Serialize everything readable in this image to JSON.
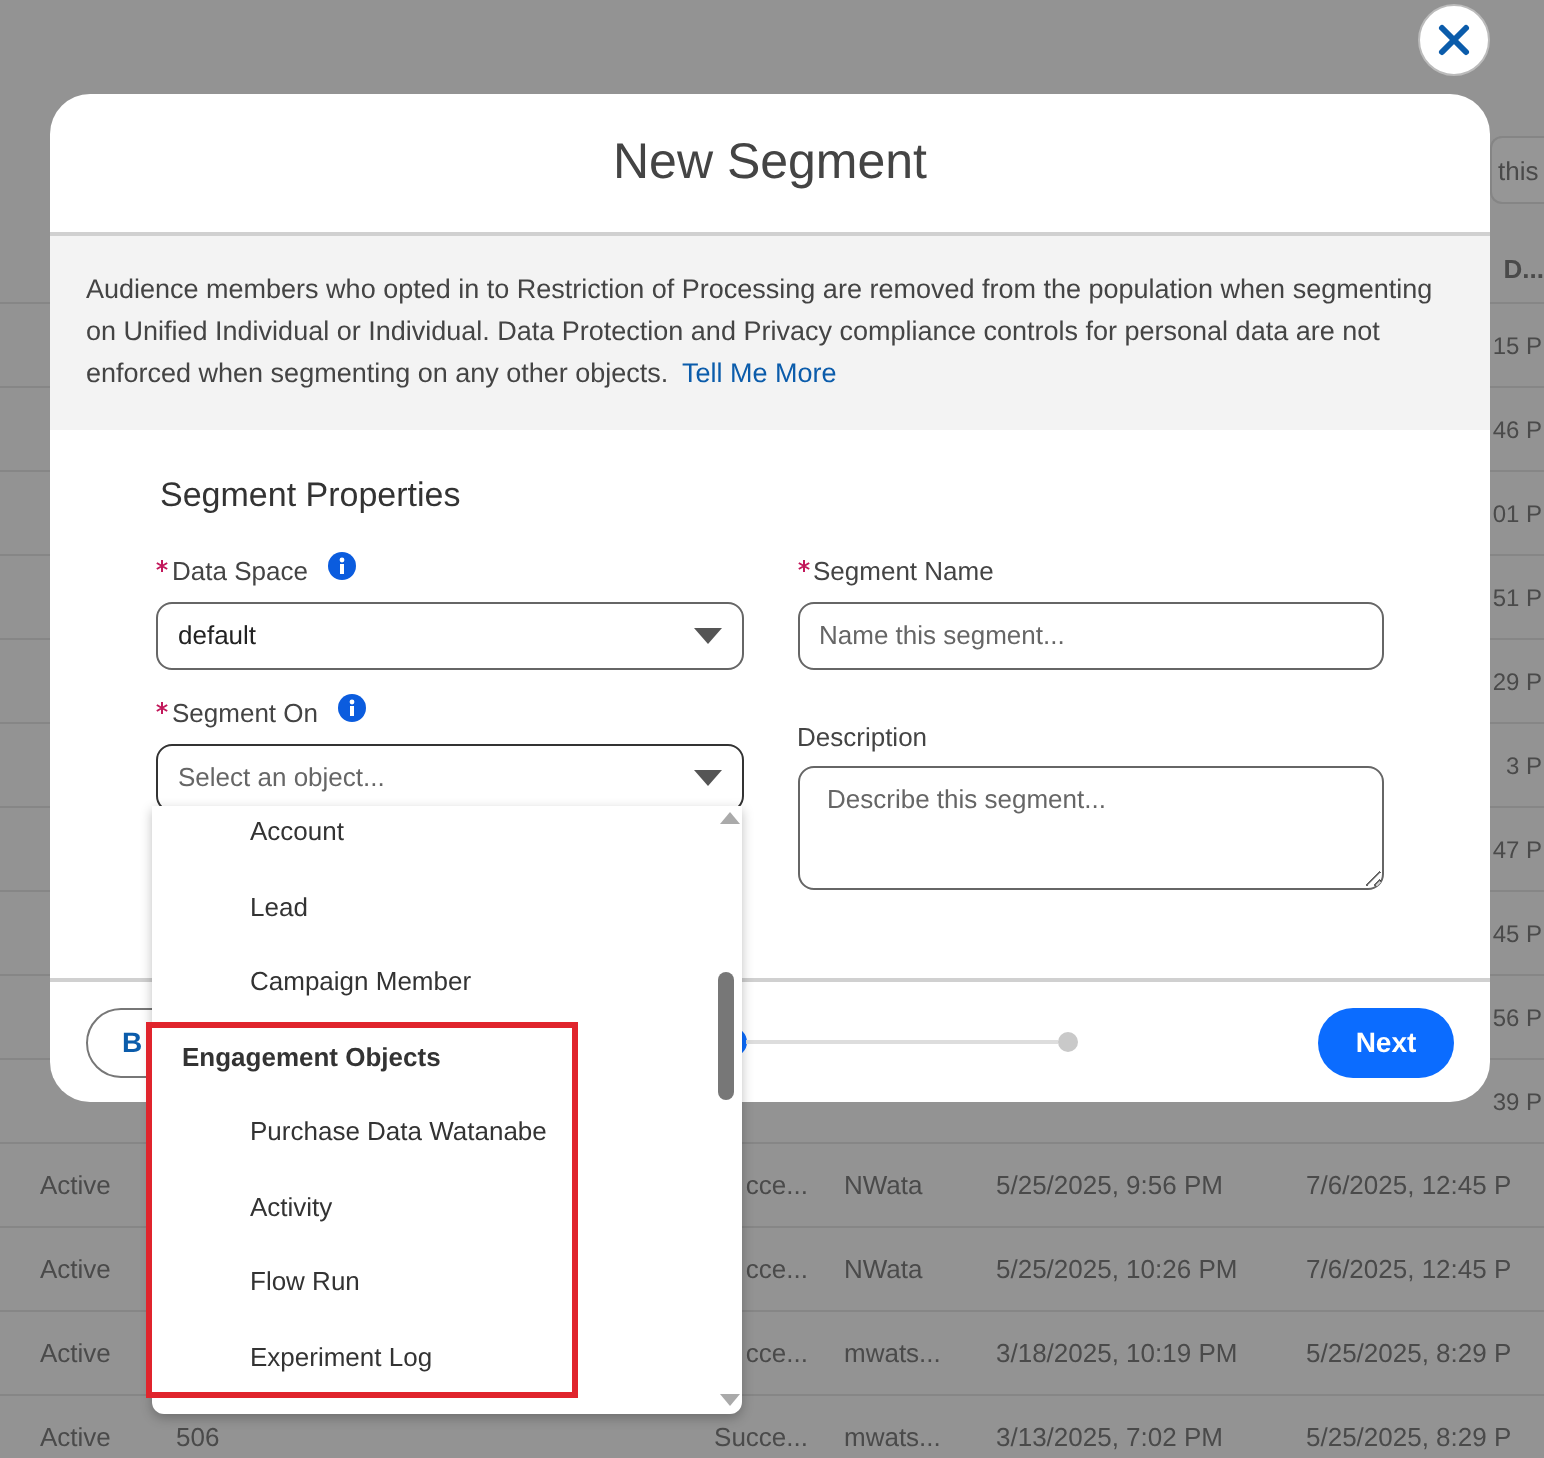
{
  "background": {
    "search_field": {
      "placeholder": "this"
    },
    "header": {
      "column_last": "D..."
    },
    "rows": [
      {
        "kind": "covered",
        "modified": "15 P"
      },
      {
        "kind": "covered",
        "modified": "46 P"
      },
      {
        "kind": "covered",
        "modified": "01 P"
      },
      {
        "kind": "covered",
        "modified": "51 P"
      },
      {
        "kind": "covered",
        "modified": "29 P"
      },
      {
        "kind": "covered",
        "modified": "3 P"
      },
      {
        "kind": "covered",
        "modified": "47 P"
      },
      {
        "kind": "covered",
        "modified": "45 P"
      },
      {
        "kind": "covered",
        "modified": "56 P"
      },
      {
        "kind": "covered",
        "modified": "39 P"
      },
      {
        "kind": "full",
        "status": "Active",
        "state": "cce...",
        "owner": "NWata",
        "created": "5/25/2025, 9:56 PM",
        "modified": "7/6/2025, 12:45 P"
      },
      {
        "kind": "full",
        "status": "Active",
        "state": "cce...",
        "owner": "NWata",
        "created": "5/25/2025, 10:26 PM",
        "modified": "7/6/2025, 12:45 P"
      },
      {
        "kind": "full",
        "status": "Active",
        "state": "cce...",
        "owner": "mwats...",
        "created": "3/18/2025, 10:19 PM",
        "modified": "5/25/2025, 8:29 P"
      },
      {
        "kind": "full",
        "status": "Active",
        "id": "506",
        "state": "Succe...",
        "owner": "mwats...",
        "created": "3/13/2025, 7:02 PM",
        "modified": "5/25/2025, 8:29 P"
      }
    ]
  },
  "modal": {
    "title": "New Segment",
    "notice": {
      "text": "Audience members who opted in to Restriction of Processing are removed from the population when segmenting on Unified Individual or Individual. Data Protection and Privacy compliance controls for personal data are not enforced when segmenting on any other objects.",
      "link": "Tell Me More"
    },
    "section_title": "Segment Properties",
    "left_fields": [
      {
        "kind": "select",
        "label": "Data Space",
        "required": true,
        "info": true,
        "value": "default",
        "open": false
      },
      {
        "kind": "select",
        "label": "Segment On",
        "required": true,
        "info": true,
        "placeholder": "Select an object...",
        "open": true
      }
    ],
    "right_fields": [
      {
        "kind": "text",
        "label": "Segment Name",
        "required": true,
        "info": false,
        "placeholder": "Name this segment..."
      },
      {
        "kind": "textarea",
        "label": "Description",
        "required": false,
        "info": false,
        "placeholder": "Describe this segment..."
      }
    ],
    "footer": {
      "back_button": "B",
      "next_button": "Next"
    }
  },
  "dropdown": {
    "items": [
      {
        "kind": "option",
        "label": "Account"
      },
      {
        "kind": "option",
        "label": "Lead"
      },
      {
        "kind": "option",
        "label": "Campaign Member"
      },
      {
        "kind": "group",
        "label": "Engagement Objects"
      },
      {
        "kind": "option",
        "label": "Purchase Data Watanabe"
      },
      {
        "kind": "option",
        "label": "Activity"
      },
      {
        "kind": "option",
        "label": "Flow Run"
      },
      {
        "kind": "option",
        "label": "Experiment Log"
      }
    ]
  }
}
